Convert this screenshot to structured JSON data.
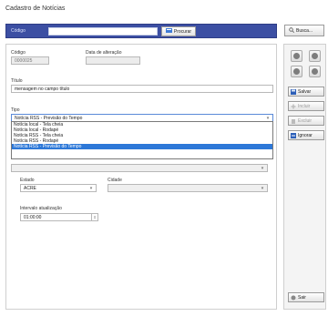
{
  "window": {
    "title": "Cadastro de Notícias"
  },
  "search": {
    "code_label": "Código",
    "code_value": "",
    "search_label": "Procurar",
    "search_right_label": "Busca..."
  },
  "form": {
    "codigo_label": "Código",
    "codigo_value": "0000025",
    "data_alteracao_label": "Data de alteração",
    "data_alteracao_value": "",
    "titulo_label": "Título",
    "titulo_value": "mensagem no campo título",
    "tipo_label": "Tipo",
    "tipo_value": "Notícia RSS - Previsão do Tempo",
    "tipo_options": [
      "Notícia local - Tela cheia",
      "Notícia local - Rodapé",
      "Notícia RSS - Tela cheia",
      "Notícia RSS - Rodapé",
      "Notícia RSS - Previsão do Tempo"
    ],
    "tipo_highlighted_index": 4,
    "fonte_value": "",
    "estado_label": "Estado",
    "estado_value": "ACRE",
    "cidade_label": "Cidade",
    "cidade_value": "",
    "intervalo_label": "Intervalo atualização",
    "intervalo_value": "01:00:00"
  },
  "actions": {
    "salvar": "Salvar",
    "incluir": "Incluir",
    "excluir": "Excluir",
    "ignorar": "Ignorar",
    "sair": "Sair"
  },
  "colors": {
    "accent": "#3c4fa3",
    "highlight": "#2d78d8"
  }
}
